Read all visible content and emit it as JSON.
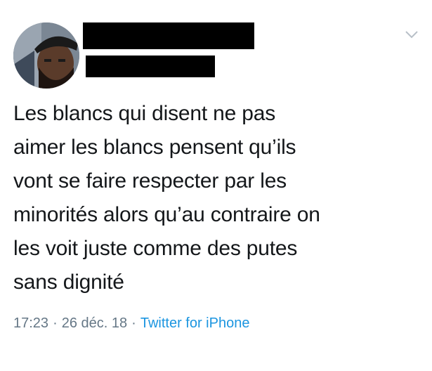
{
  "tweet": {
    "text": "Les blancs qui disent ne pas\naimer les blancs pensent qu’ils\nvont se faire respecter par les\nminorités alors qu’au contraire on\nles voit juste comme des putes\nsans dignité",
    "time": "17:23",
    "date": "26 déc. 18",
    "separator": "·",
    "source": "Twitter for iPhone"
  },
  "icons": {
    "menu": "chevron-down-icon",
    "avatar": "profile-photo"
  },
  "colors": {
    "text": "#14171a",
    "meta": "#657786",
    "link": "#1b95e0"
  }
}
